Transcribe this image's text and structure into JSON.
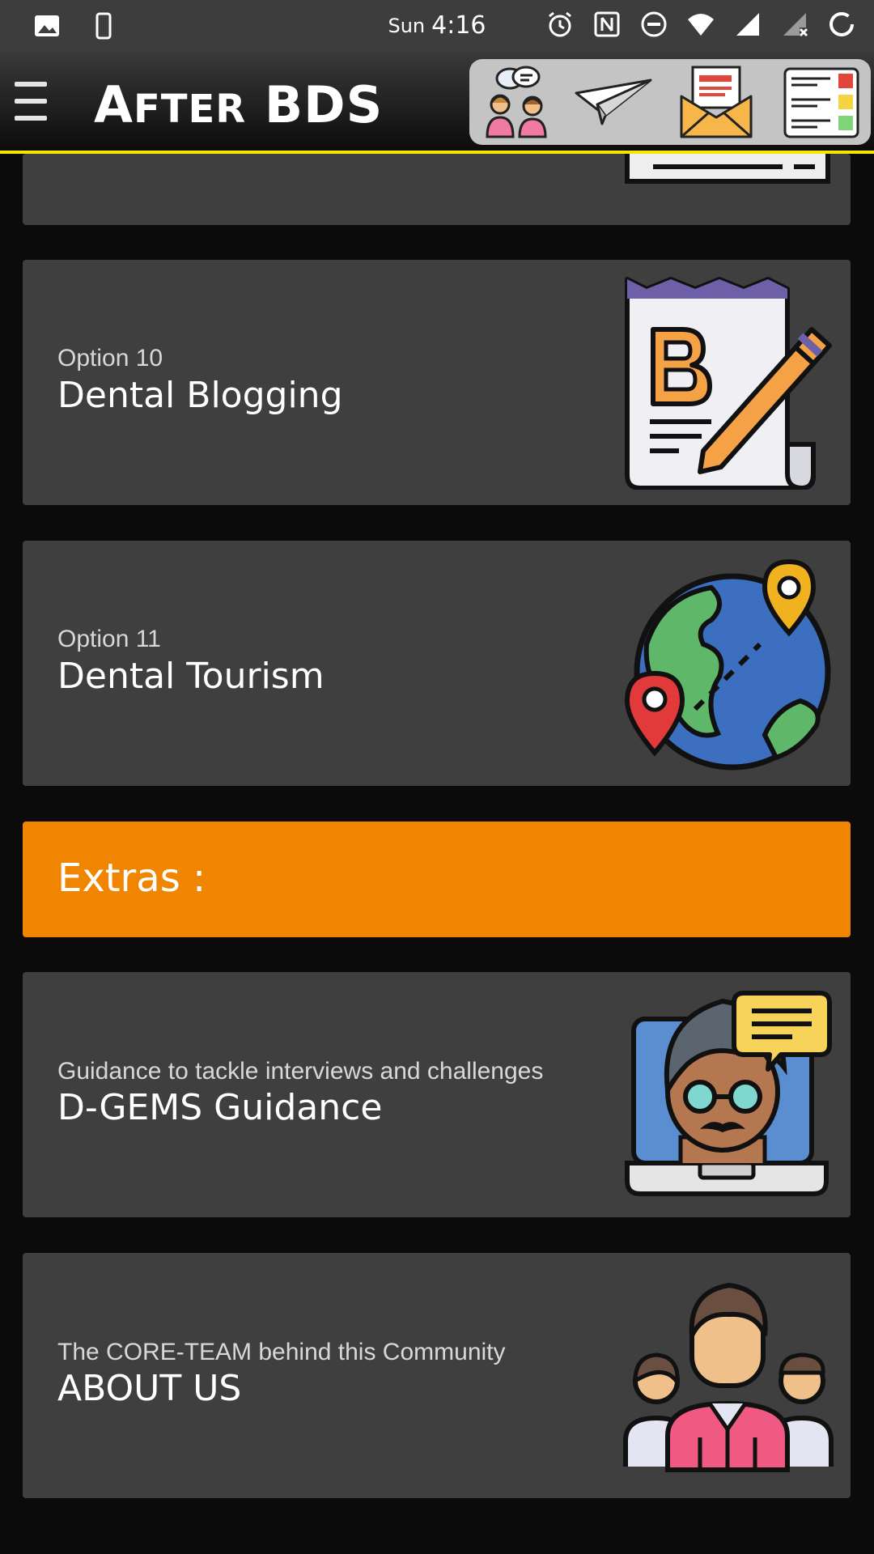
{
  "status_bar": {
    "day": "Sun",
    "time": "4:16",
    "left_icons": [
      "image-icon",
      "phone-icon"
    ],
    "right_icons": [
      "alarm-icon",
      "nfc-icon",
      "do-not-disturb-icon",
      "wifi-icon",
      "signal-icon",
      "signal-x-icon",
      "battery-ring-icon"
    ]
  },
  "app_bar": {
    "title": "AFTER BDS",
    "title_first_letter": "A",
    "title_rest": "FTER",
    "title_last": "BDS",
    "underline_color": "#f5e600",
    "actions": [
      "chat-people-icon",
      "paper-plane-icon",
      "mail-icon",
      "list-icon"
    ]
  },
  "cards": [
    {
      "subtitle": "Option 10",
      "title": "Dental Blogging",
      "icon": "blog-edit-icon"
    },
    {
      "subtitle": "Option 11",
      "title": "Dental Tourism",
      "icon": "globe-pins-icon"
    }
  ],
  "extras": {
    "label": "Extras :",
    "color": "#ef8500"
  },
  "extra_cards": [
    {
      "subtitle": "Guidance to tackle interviews and challenges",
      "title": "D-GEMS Guidance",
      "icon": "mentor-laptop-icon"
    },
    {
      "subtitle": "The CORE-TEAM behind this Community",
      "title": "ABOUT US",
      "icon": "team-icon"
    }
  ]
}
